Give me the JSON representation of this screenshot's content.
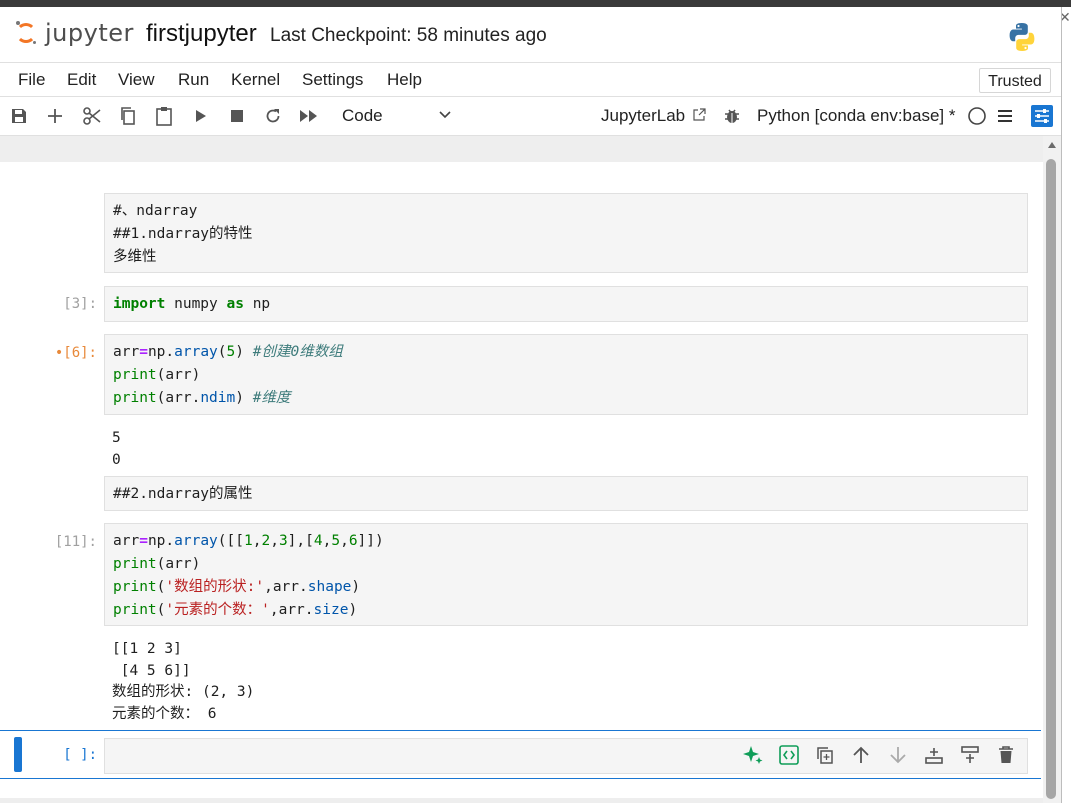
{
  "header": {
    "logo_text": "jupyter",
    "notebook_name": "firstjupyter",
    "checkpoint": "Last Checkpoint: 58 minutes ago"
  },
  "menu": {
    "items": [
      "File",
      "Edit",
      "View",
      "Run",
      "Kernel",
      "Settings",
      "Help"
    ],
    "trusted": "Trusted"
  },
  "toolbar": {
    "cell_type": "Code",
    "jupyterlab": "JupyterLab",
    "kernel": "Python [conda env:base] *"
  },
  "cells": {
    "md1": {
      "lines": [
        "#、ndarray",
        "##1.ndarray的特性",
        "多维性"
      ]
    },
    "c3": {
      "prompt": "[3]:",
      "tokens": [
        "import",
        " numpy ",
        "as",
        " np"
      ]
    },
    "c6": {
      "prompt": "•[6]:",
      "line1": [
        "arr",
        "=",
        "np.",
        "array",
        "(",
        "5",
        ") ",
        "#创建0维数组"
      ],
      "line2": [
        "print",
        "(arr)"
      ],
      "line3": [
        "print",
        "(arr.",
        "ndim",
        ") ",
        "#维度"
      ],
      "output": "5\n0"
    },
    "md2": {
      "lines": [
        "##2.ndarray的属性"
      ]
    },
    "c11": {
      "prompt": "[11]:",
      "line1": [
        "arr",
        "=",
        "np.",
        "array",
        "([[",
        "1",
        ",",
        "2",
        ",",
        "3",
        "],[",
        "4",
        ",",
        "5",
        ",",
        "6",
        "]])"
      ],
      "line2": [
        "print",
        "(arr)"
      ],
      "line3": [
        "print",
        "(",
        "'数组的形状:'",
        ",arr.",
        "shape",
        ")"
      ],
      "line4": [
        "print",
        "(",
        "'元素的个数：'",
        ",arr.",
        "size",
        ")"
      ],
      "output": "[[1 2 3]\n [4 5 6]]\n数组的形状: (2, 3)\n元素的个数： 6"
    },
    "empty": {
      "prompt": "[ ]:"
    }
  },
  "colors": {
    "accent": "#1976d2",
    "keyword": "#008000",
    "string": "#ba2121",
    "comment": "#3d7b7b",
    "operator": "#aa22ff",
    "dirty_prompt": "#e8893a"
  },
  "icons": {
    "toolbar": [
      "save-icon",
      "add-icon",
      "cut-icon",
      "copy-icon",
      "paste-icon",
      "run-icon",
      "stop-icon",
      "restart-icon",
      "run-all-icon"
    ],
    "cell_tools": [
      "ai-sparkle-icon",
      "code-format-icon",
      "duplicate-icon",
      "move-up-icon",
      "move-down-icon",
      "insert-below-icon",
      "insert-above-icon",
      "delete-icon"
    ]
  }
}
